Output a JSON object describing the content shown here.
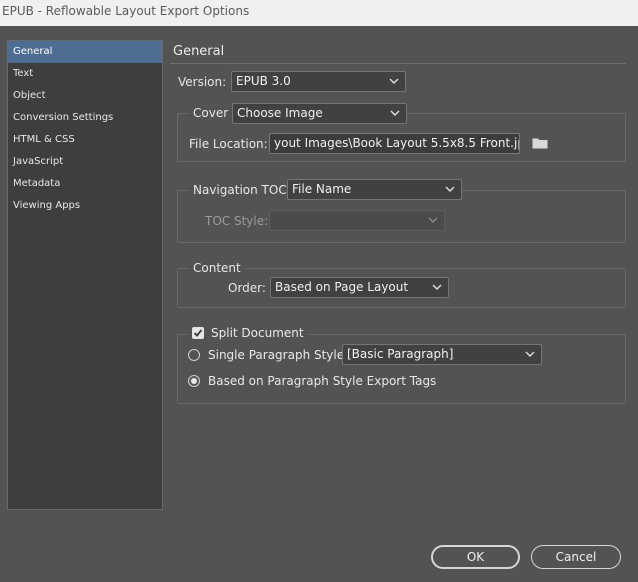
{
  "window": {
    "title": "EPUB - Reflowable Layout Export Options"
  },
  "sidebar": {
    "items": [
      {
        "label": "General"
      },
      {
        "label": "Text"
      },
      {
        "label": "Object"
      },
      {
        "label": "Conversion Settings"
      },
      {
        "label": "HTML & CSS"
      },
      {
        "label": "JavaScript"
      },
      {
        "label": "Metadata"
      },
      {
        "label": "Viewing Apps"
      }
    ],
    "selected": "General"
  },
  "general": {
    "title": "General",
    "version_label": "Version:",
    "version_value": "EPUB 3.0",
    "cover_label": "Cover",
    "cover_value": "Choose Image",
    "file_location_label": "File Location:",
    "file_location_value": "yout Images\\Book Layout 5.5x8.5 Front.jpg",
    "folder_icon": "folder-icon",
    "nav_toc_label": "Navigation TOC",
    "nav_toc_value": "File Name",
    "toc_style_label": "TOC Style:",
    "toc_style_value": "",
    "content_label": "Content",
    "order_label": "Order:",
    "order_value": "Based on Page Layout",
    "split_document_label": "Split Document",
    "split_document_checked": true,
    "single_paragraph_label": "Single Paragraph Style",
    "single_paragraph_value": "[Basic Paragraph]",
    "export_tags_label": "Based on Paragraph Style Export Tags",
    "selected_split_option": "Based on Paragraph Style Export Tags"
  },
  "buttons": {
    "ok": "OK",
    "cancel": "Cancel"
  },
  "colors": {
    "accent": "#4d6d92",
    "background": "#535353"
  }
}
